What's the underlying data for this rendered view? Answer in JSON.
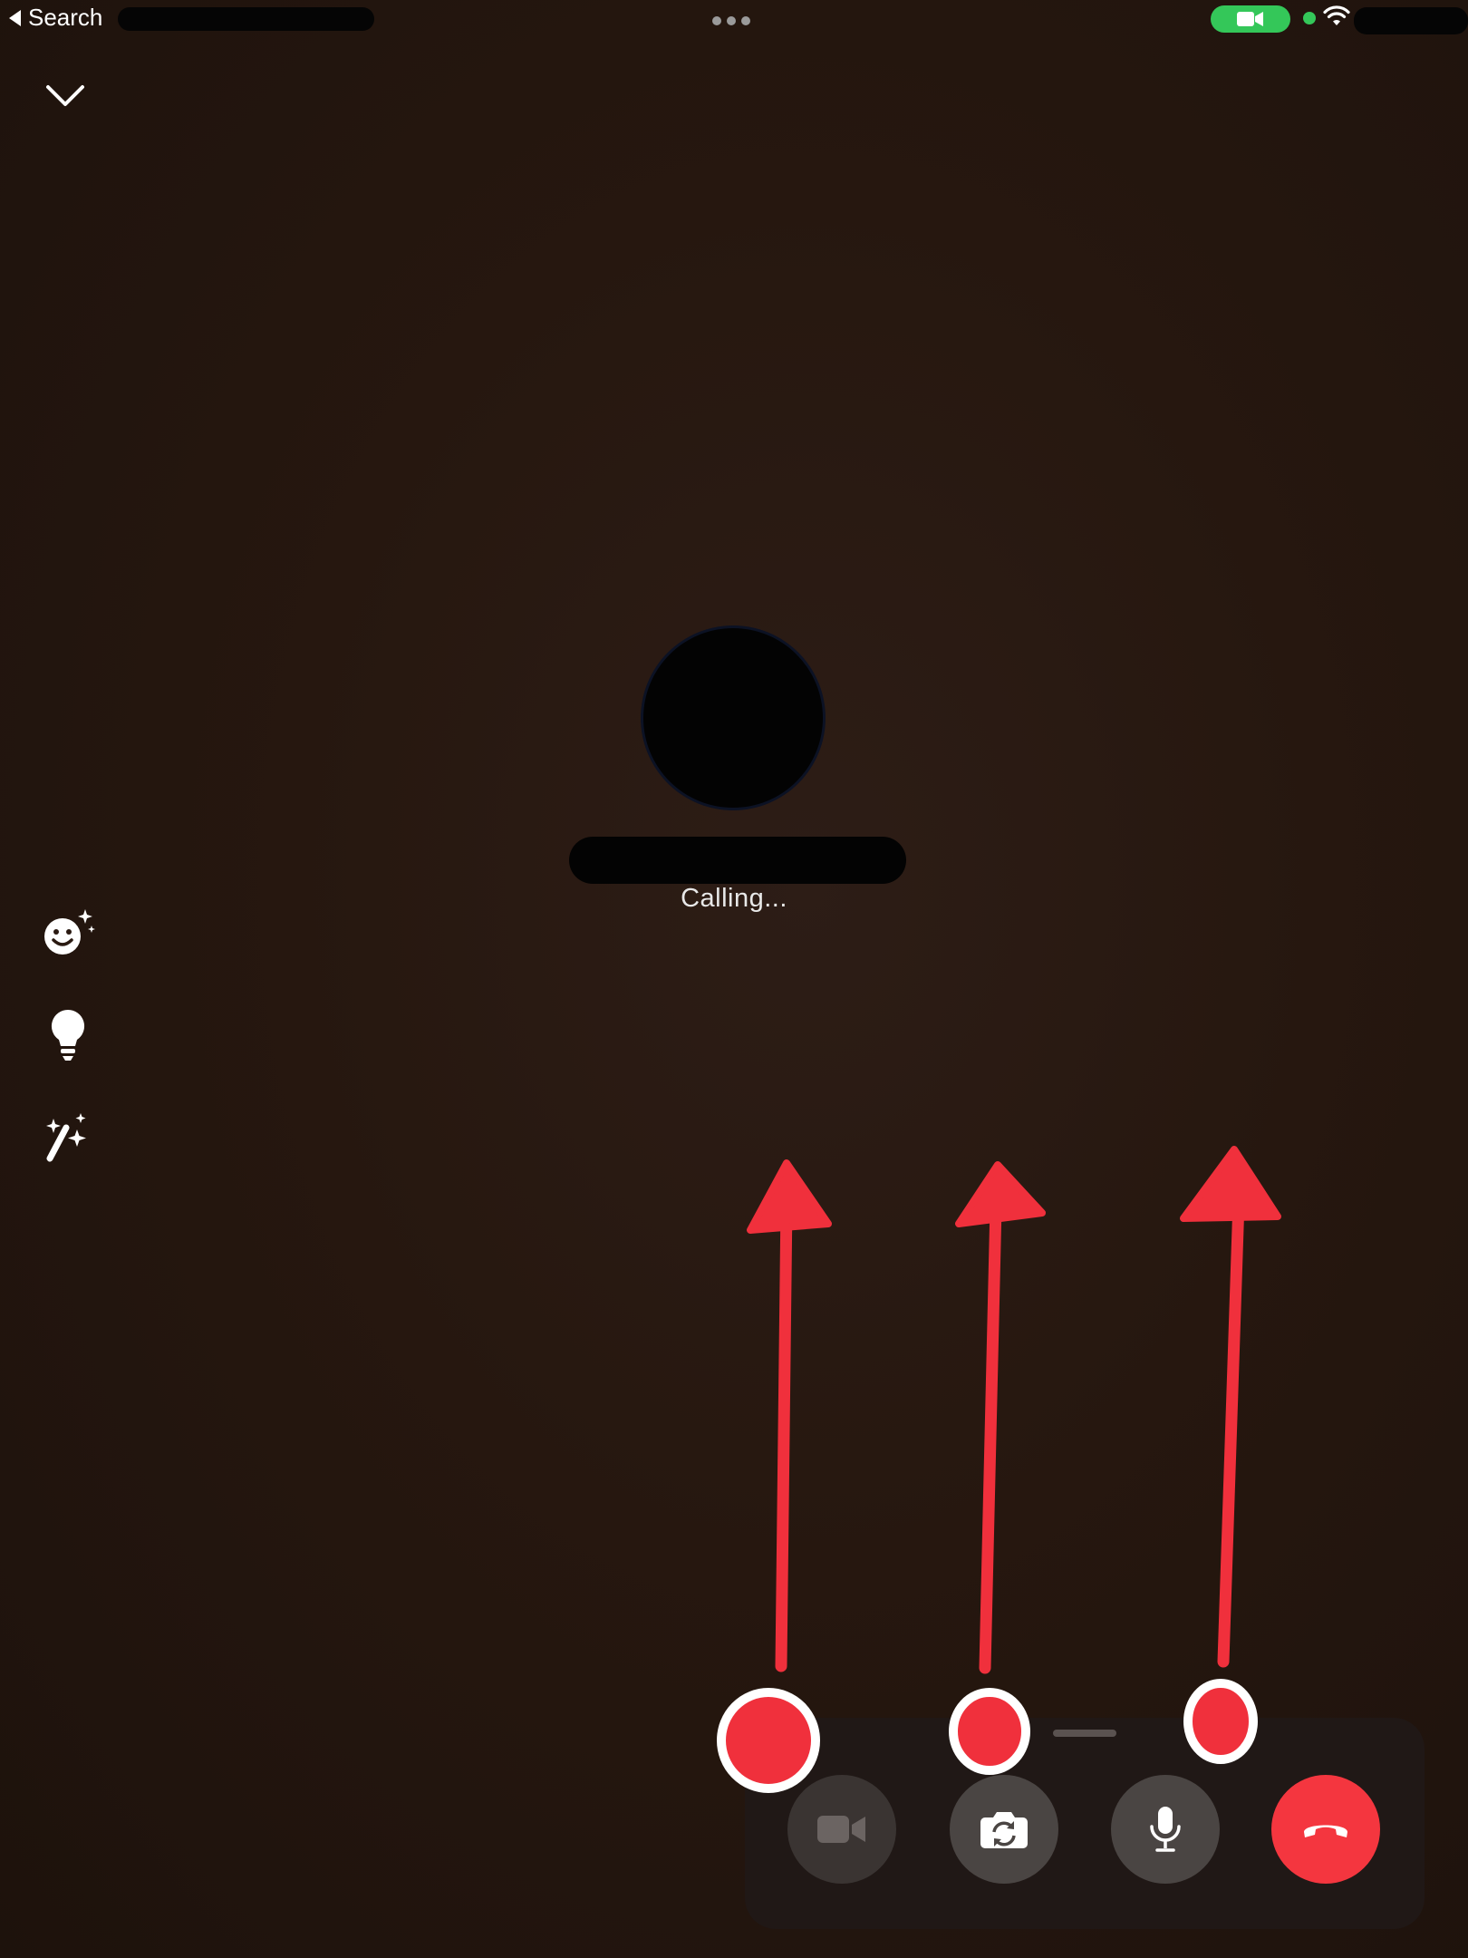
{
  "status_bar": {
    "back_label": "Search",
    "back_icon": "back-triangle-icon",
    "multitask_icon": "ellipsis-icon",
    "camera_indicator_icon": "video-camera-icon",
    "wifi_icon": "wifi-icon"
  },
  "header": {
    "collapse_icon": "chevron-down-icon"
  },
  "call": {
    "status_text": "Calling..."
  },
  "side_tools": [
    {
      "name": "effects",
      "icon": "sparkle-smiley-icon"
    },
    {
      "name": "lighting",
      "icon": "lightbulb-icon"
    },
    {
      "name": "magic",
      "icon": "magic-wand-icon"
    }
  ],
  "controls": [
    {
      "name": "video",
      "icon": "video-camera-icon",
      "state": "disabled"
    },
    {
      "name": "flip-camera",
      "icon": "flip-camera-icon",
      "state": "enabled"
    },
    {
      "name": "microphone",
      "icon": "microphone-icon",
      "state": "enabled"
    },
    {
      "name": "end-call",
      "icon": "phone-hangup-icon",
      "state": "danger"
    }
  ],
  "colors": {
    "background": "#26170f",
    "end_call": "#f4363f",
    "indicator_green": "#34c759",
    "annotation_red": "#f0303c"
  }
}
